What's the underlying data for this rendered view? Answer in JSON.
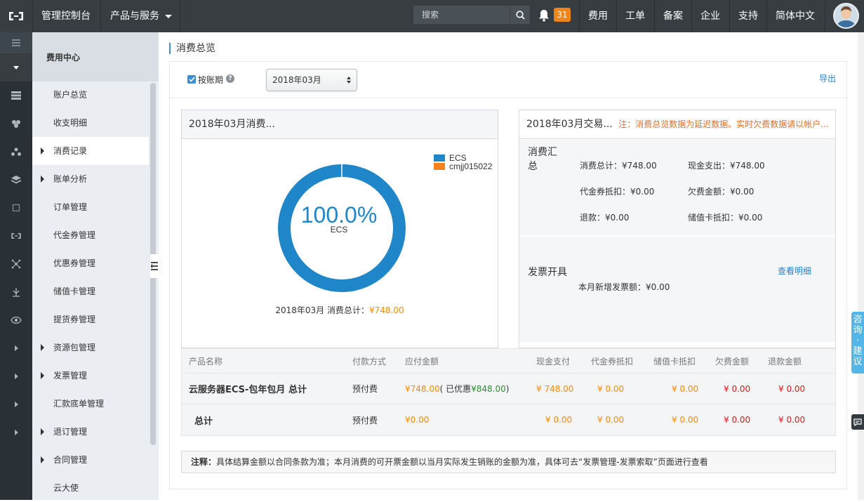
{
  "topbar": {
    "console": "管理控制台",
    "products": "产品与服务",
    "search_placeholder": "搜索",
    "notification_count": "31",
    "links": [
      "费用",
      "工单",
      "备案",
      "企业",
      "支持",
      "简体中文"
    ]
  },
  "sidebar": {
    "header": "费用中心",
    "items": [
      {
        "label": "账户总览",
        "expandable": false
      },
      {
        "label": "收支明细",
        "expandable": false
      },
      {
        "label": "消费记录",
        "expandable": true
      },
      {
        "label": "账单分析",
        "expandable": true
      },
      {
        "label": "订单管理",
        "expandable": false
      },
      {
        "label": "代金券管理",
        "expandable": false
      },
      {
        "label": "优惠券管理",
        "expandable": false
      },
      {
        "label": "储值卡管理",
        "expandable": false
      },
      {
        "label": "提货券管理",
        "expandable": false
      },
      {
        "label": "资源包管理",
        "expandable": true
      },
      {
        "label": "发票管理",
        "expandable": true
      },
      {
        "label": "汇款底单管理",
        "expandable": false
      },
      {
        "label": "退订管理",
        "expandable": true
      },
      {
        "label": "合同管理",
        "expandable": true
      },
      {
        "label": "云大使",
        "expandable": false
      }
    ]
  },
  "page": {
    "title": "消费总览",
    "by_period_label": "按账期",
    "month_selected": "2018年03月",
    "export": "导出"
  },
  "donut_card": {
    "title": "2018年03月消费...",
    "center_value": "100.0%",
    "center_label": "ECS",
    "total_prefix": "2018年03月 消费总计：",
    "total_value": "¥748.00"
  },
  "chart_data": {
    "type": "pie",
    "categories": [
      "ECS",
      "cmjj015022"
    ],
    "values": [
      100.0,
      0.0
    ],
    "colors": [
      "#1f87c9",
      "#f5821f"
    ],
    "legend_position": "top-right"
  },
  "summary_card": {
    "title": "2018年03月交易...",
    "notice": "注：消费总览数据为延迟数据。实时欠费数据请以帐户...",
    "summary_title": "消费汇总",
    "fields": [
      {
        "label": "消费总计：",
        "value": "¥748.00"
      },
      {
        "label": "现金支出：",
        "value": "¥748.00"
      },
      {
        "label": "代金券抵扣：",
        "value": "¥0.00"
      },
      {
        "label": "欠费金额：",
        "value": "¥0.00"
      },
      {
        "label": "退款：",
        "value": "¥0.00"
      },
      {
        "label": "储值卡抵扣：",
        "value": "¥0.00"
      }
    ],
    "invoice_title": "发票开具",
    "invoice_link": "查看明细",
    "invoice_label": "本月新增发票额：",
    "invoice_value": "¥0.00"
  },
  "table": {
    "headers": [
      "产品名称",
      "付款方式",
      "应付金额",
      "现金支付",
      "代金券抵扣",
      "储值卡抵扣",
      "欠费金额",
      "退款金额"
    ],
    "rows": [
      {
        "name": "云服务器ECS-包年包月  总计",
        "pay": "预付费",
        "due": "¥748.00",
        "discount_prefix": "( 已优惠",
        "discount": "¥848.00",
        "discount_suffix": ")",
        "cash": "¥ 748.00",
        "voucher": "¥ 0.00",
        "card": "¥ 0.00",
        "owed": "¥ 0.00",
        "refund": "¥ 0.00"
      },
      {
        "name": "总计",
        "pay": "预付费",
        "due": "¥0.00",
        "cash": "¥ 0.00",
        "voucher": "¥ 0.00",
        "card": "¥ 0.00",
        "owed": "¥ 0.00",
        "refund": "¥ 0.00"
      }
    ]
  },
  "note": {
    "label": "注释：",
    "text": "具体结算金额以合同条款为准；本月消费的可开票金额以当月实际发生销账的金额为准，具体可去“发票管理-发票索取”页面进行查看"
  },
  "feedback": {
    "text": "咨询·建议"
  }
}
